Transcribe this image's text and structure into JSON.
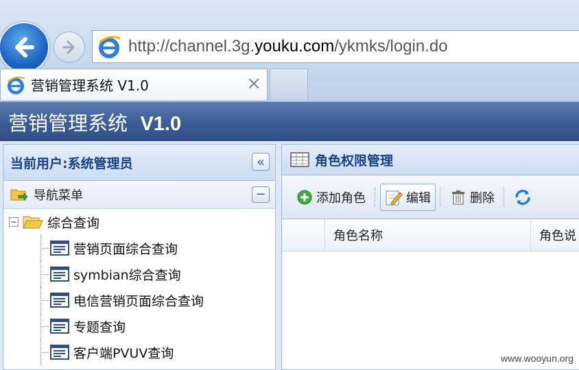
{
  "browser": {
    "url_prefix": "http://channel.3g.",
    "url_domain": "youku.com",
    "url_path": "/ykmks/login.do",
    "tab_title": "营销管理系统 V1.0",
    "tab_close": "×"
  },
  "app": {
    "title_cn": "营销管理系统",
    "title_version": "V1.0"
  },
  "left_panel": {
    "current_user": "当前用户:系统管理员",
    "collapse_glyph": "«",
    "nav_title": "导航菜单",
    "minus_glyph": "−",
    "tree": {
      "root_label": "综合查询",
      "root_toggle": "−",
      "items": [
        {
          "label": "营销页面综合查询"
        },
        {
          "label": "symbian综合查询"
        },
        {
          "label": "电信营销页面综合查询"
        },
        {
          "label": "专题查询"
        },
        {
          "label": "客户端PVUV查询"
        }
      ]
    }
  },
  "right_panel": {
    "title": "角色权限管理",
    "toolbar": {
      "add_label": "添加角色",
      "edit_label": "编辑",
      "delete_label": "删除"
    },
    "grid": {
      "columns": [
        "角色名称",
        "角色说"
      ]
    }
  },
  "watermark": "www.wooyun.org",
  "colors": {
    "header_blue": "#3e5e97",
    "panel_title": "#15428b",
    "panel_border": "#99bbe8"
  }
}
